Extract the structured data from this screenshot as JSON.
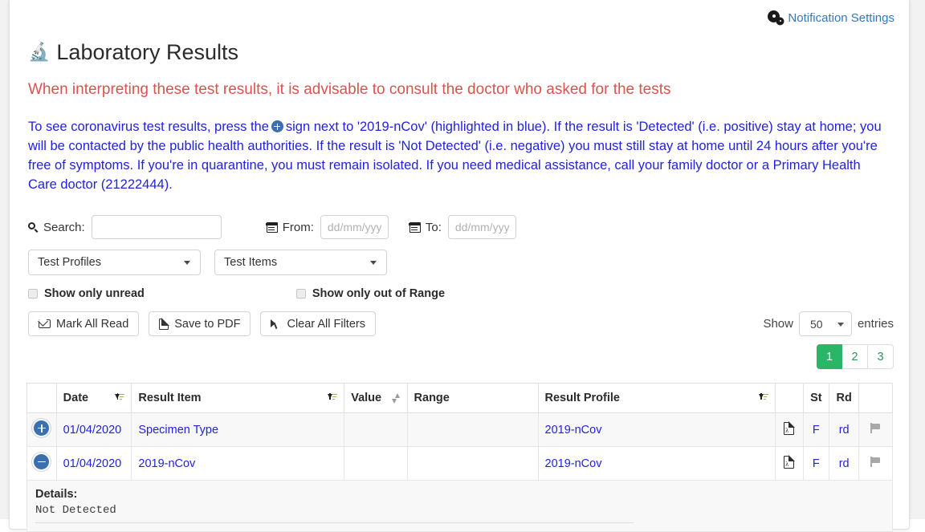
{
  "header": {
    "notification_settings": "Notification Settings",
    "notification_icon": "cogs-icon"
  },
  "title": {
    "icon": "microscope-icon",
    "icon_glyph": "🔬",
    "text": "Laboratory Results"
  },
  "messages": {
    "warning": "When interpreting these test results, it is advisable to consult the doctor who asked for the tests",
    "info_part1": "To see coronavirus test results, press the",
    "info_icon": "plus-circle-icon",
    "info_part2": "sign next to '2019-nCov' (highlighted in blue). If the result is 'Detected' (i.e. positive) stay at home; you will be contacted by the public health authorities. If the result is 'Not Detected' (i.e. negative) you must still stay at home until 24 hours after you're free of symptoms. If you're in quarantine, you must remain isolated. If you need medical assistance, call your family doctor or a Primary Health Care doctor (21222444)."
  },
  "filters": {
    "search_label": "Search:",
    "search_value": "",
    "search_placeholder": "",
    "from_label": "From:",
    "from_value": "",
    "from_placeholder": "dd/mm/yyyy",
    "to_label": "To:",
    "to_value": "",
    "to_placeholder": "dd/mm/yyyy",
    "test_profiles": "Test Profiles",
    "test_items": "Test Items",
    "show_only_unread": "Show only unread",
    "show_only_out_of_range": "Show only out of Range"
  },
  "actions": {
    "mark_all_read": "Mark All Read",
    "save_to_pdf": "Save to PDF",
    "clear_all_filters": "Clear All Filters"
  },
  "entries": {
    "show_label": "Show",
    "value": "50",
    "entries_label": "entries"
  },
  "pagination": {
    "pages": [
      "1",
      "2",
      "3"
    ],
    "active": "1",
    "active_color": "#2ab567"
  },
  "table": {
    "columns": [
      {
        "label": "",
        "sort": "none"
      },
      {
        "label": "Date",
        "sort": "numeric-desc"
      },
      {
        "label": "Result Item",
        "sort": "alpha-desc"
      },
      {
        "label": "Value",
        "sort": "both"
      },
      {
        "label": "Range",
        "sort": "none"
      },
      {
        "label": "Result Profile",
        "sort": "alpha-desc"
      },
      {
        "label": "",
        "sort": "none"
      },
      {
        "label": "St",
        "sort": "none"
      },
      {
        "label": "Rd",
        "sort": "none"
      },
      {
        "label": "",
        "sort": "none"
      }
    ],
    "rows": [
      {
        "expand": "plus",
        "date": "01/04/2020",
        "result_item": "Specimen Type",
        "value": "",
        "range": "",
        "result_profile": "2019-nCov",
        "doc_icon": "pdf-icon",
        "st": "F",
        "rd": "rd",
        "flag_icon": "flag-icon"
      },
      {
        "expand": "minus",
        "date": "01/04/2020",
        "result_item": "2019-nCov",
        "value": "",
        "range": "",
        "result_profile": "2019-nCov",
        "doc_icon": "pdf-icon",
        "st": "F",
        "rd": "rd",
        "flag_icon": "flag-icon"
      }
    ]
  },
  "details": {
    "label": "Details:",
    "value": "Not Detected"
  },
  "colors": {
    "warning_red": "#d9534f",
    "info_blue": "#2222dd",
    "link_blue": "#3777bc",
    "accent_green": "#2ab567"
  }
}
